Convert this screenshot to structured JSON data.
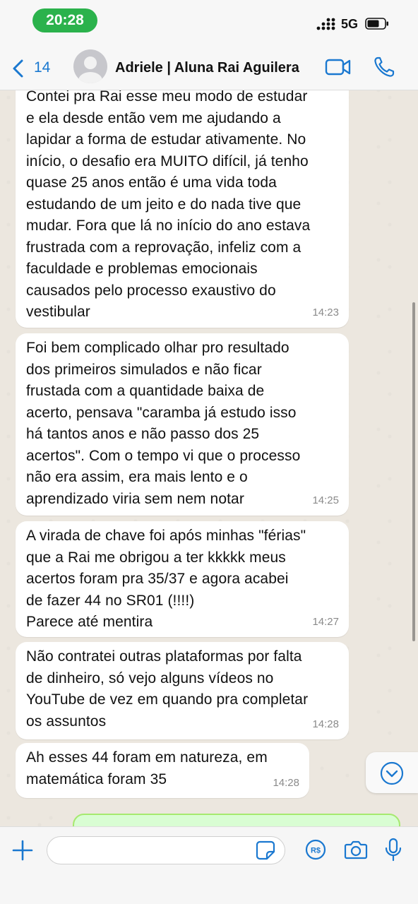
{
  "status_bar": {
    "time": "20:28",
    "network": "5G"
  },
  "header": {
    "back_count": "14",
    "contact_name": "Adriele | Aluna Rai Aguilera"
  },
  "messages": [
    {
      "text": "Contei pra Rai esse meu modo de estudar\ne ela desde então vem me ajudando a\nlapidar a forma de estudar ativamente. No\ninício, o desafio era MUITO difícil, já tenho\nquase 25 anos então é uma vida toda\nestudando de um jeito e do nada tive que\nmudar. Fora que lá no início do ano estava\nfrustrada com a reprovação, infeliz com a\nfaculdade e problemas emocionais\ncausados pelo processo exaustivo do\nvestibular",
      "time": "14:23"
    },
    {
      "text": "Foi bem complicado olhar pro resultado\ndos primeiros simulados e não ficar\nfrustada com a quantidade baixa de\nacerto, pensava \"caramba já estudo isso\nhá tantos anos e não passo dos 25\nacertos\". Com o tempo vi que o processo\nnão era assim, era mais lento e o\naprendizado viria sem nem notar",
      "time": "14:25"
    },
    {
      "text": "A virada de chave foi após minhas \"férias\"\nque a Rai me obrigou a ter kkkkk meus\nacertos foram pra 35/37 e agora acabei\nde fazer 44 no SR01 (!!!!)\nParece até mentira",
      "time": "14:27"
    },
    {
      "text": "Não contratei outras plataformas por falta\nde dinheiro, só vejo alguns vídeos no\nYouTube de vez em quando pra completar\nos assuntos",
      "time": "14:28"
    },
    {
      "text": "Ah esses 44 foram em natureza, em\nmatemática foram 35",
      "time": "14:28"
    }
  ],
  "input": {
    "placeholder": ""
  },
  "colors": {
    "accent": "#1a78d0",
    "time_pill": "#2bb24c",
    "bubble_in": "#ffffff",
    "bubble_out": "#d9fdd3"
  }
}
